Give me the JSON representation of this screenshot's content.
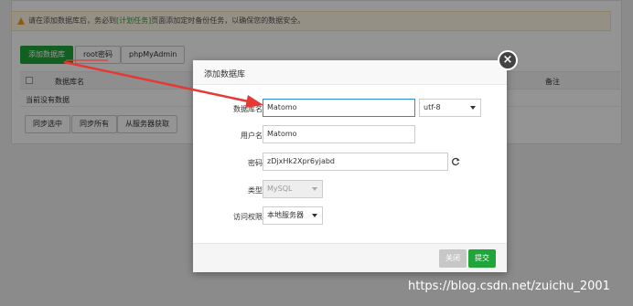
{
  "notice": {
    "text_before": "请在添加数据库后，务必到",
    "link": "[计划任务]",
    "text_after": "页面添加定时备份任务，以确保您的数据安全。"
  },
  "toolbar": {
    "add_db": "添加数据库",
    "root_pwd": "root密码",
    "phpmyadmin": "phpMyAdmin"
  },
  "table": {
    "col_name": "数据库名",
    "col_note": "备注",
    "empty": "当前没有数据"
  },
  "actions": {
    "sync_selected": "同步选中",
    "sync_all": "同步所有",
    "fetch_server": "从服务器获取"
  },
  "modal": {
    "title": "添加数据库",
    "close": "×",
    "fields": {
      "dbname_label": "数据库名",
      "dbname_value": "Matomo",
      "charset_value": "utf-8",
      "user_label": "用户名",
      "user_value": "Matomo",
      "pwd_label": "密码",
      "pwd_value": "zDjxHk2Xpr6yjabd",
      "type_label": "类型",
      "type_value": "MySQL",
      "access_label": "访问权限",
      "access_value": "本地服务器"
    },
    "cancel": "关闭",
    "submit": "提交"
  },
  "watermark": "https://blog.csdn.net/zuichu_2001",
  "colors": {
    "accent_green": "#20a53a",
    "arrow_red": "#e53935",
    "focus_blue": "#2e8bcf"
  },
  "icons": [
    "warning-icon",
    "refresh-icon",
    "close-icon",
    "chevron-down-icon"
  ]
}
